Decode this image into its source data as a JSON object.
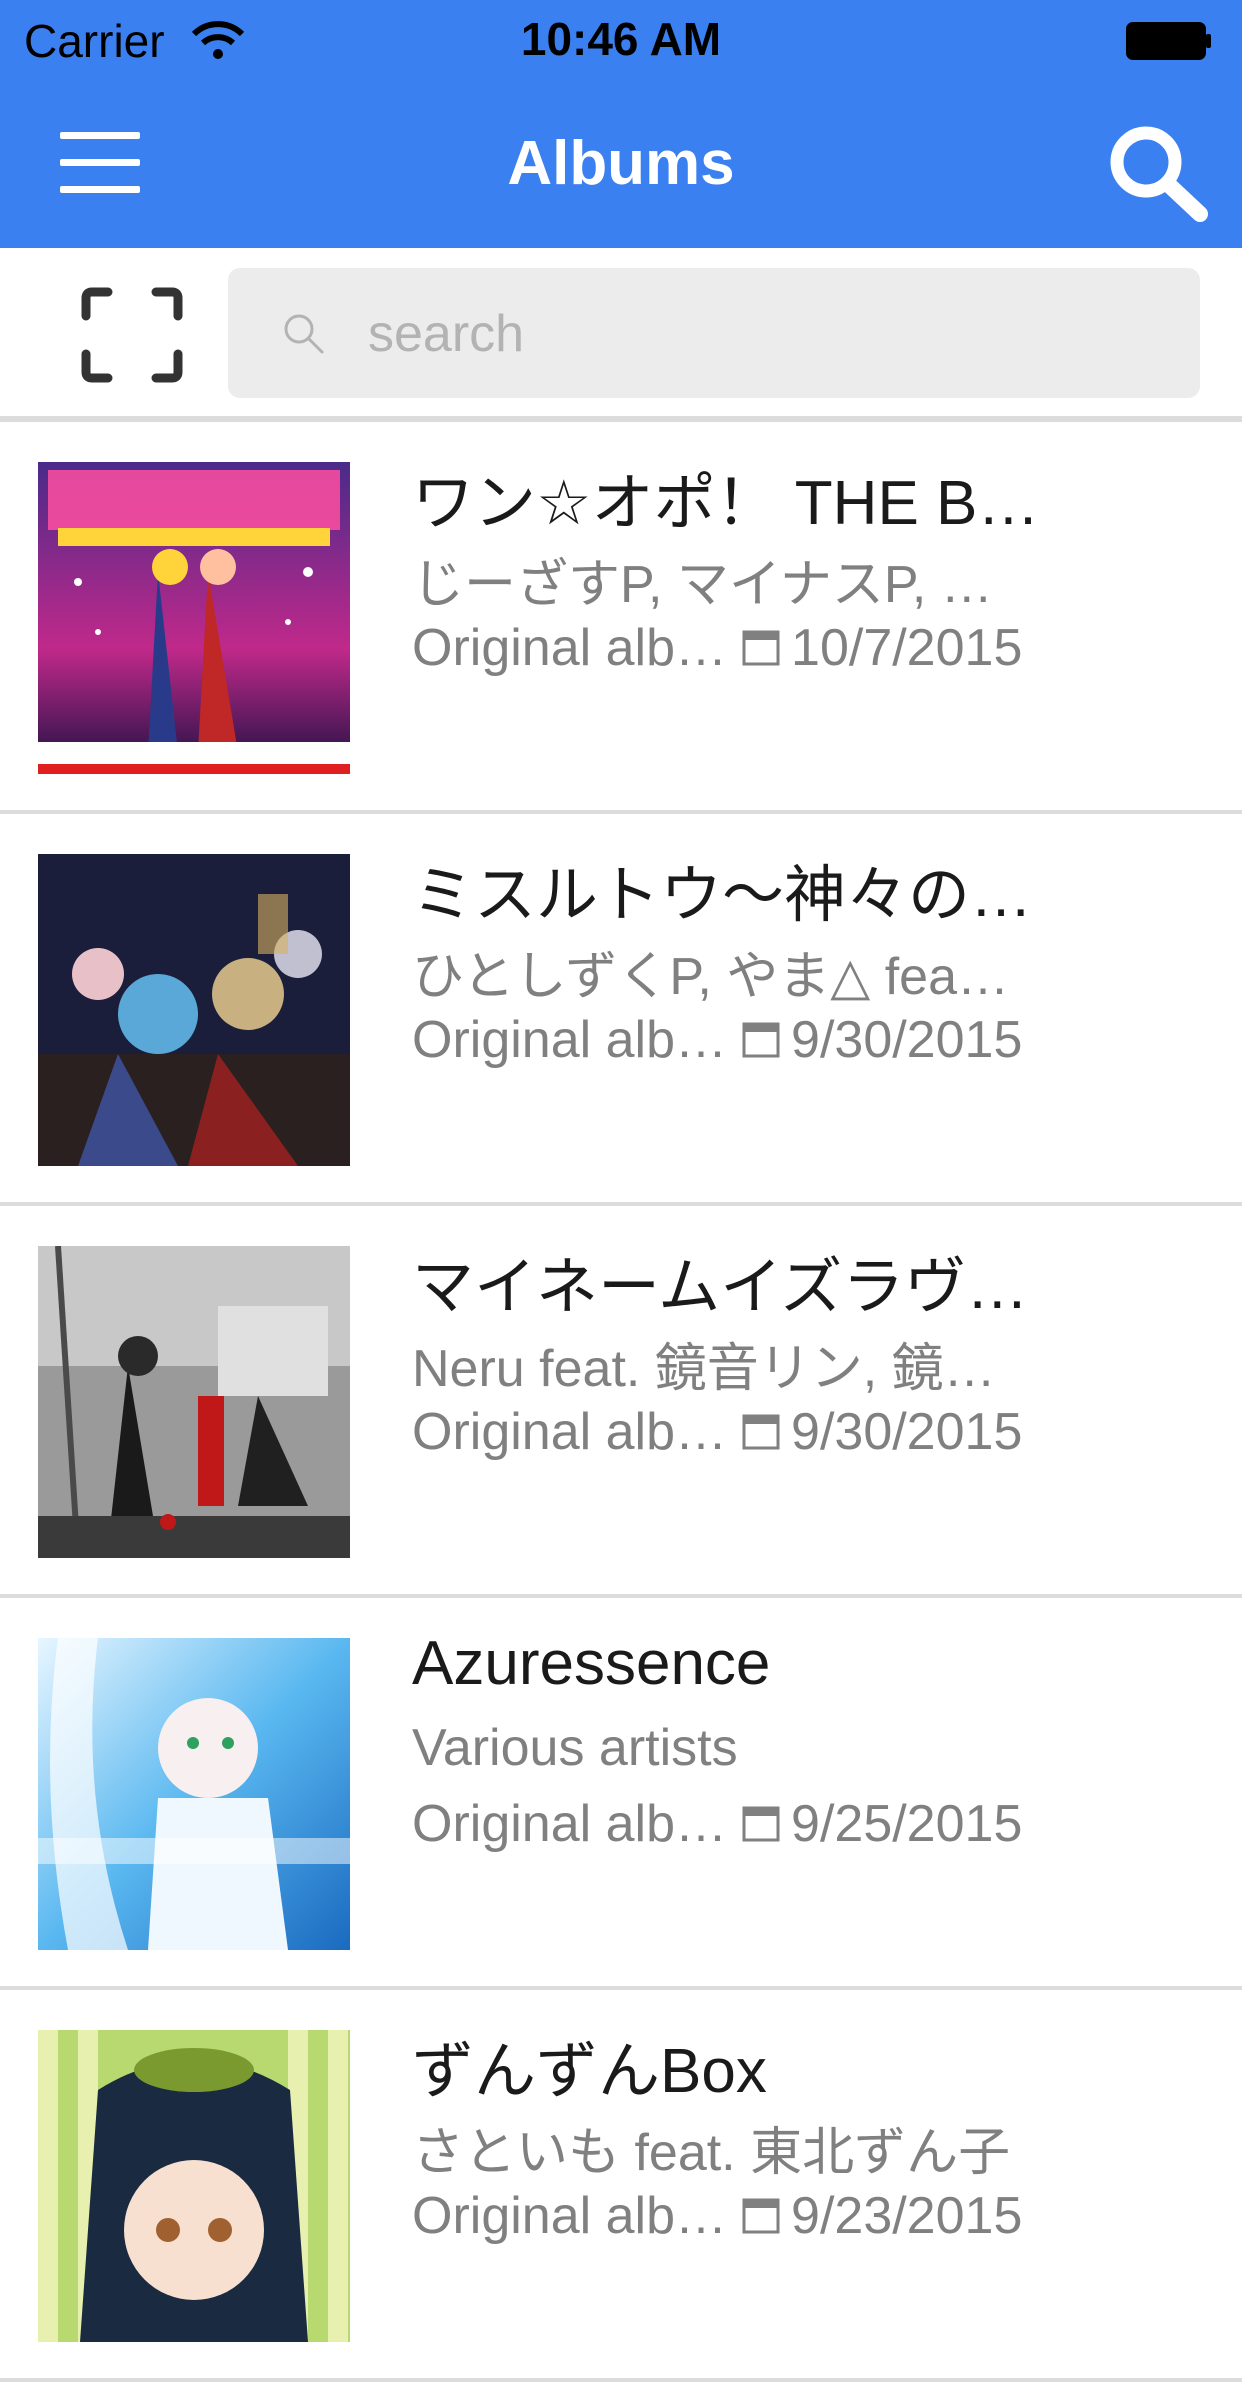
{
  "status_bar": {
    "carrier": "Carrier",
    "time": "10:46 AM"
  },
  "nav": {
    "title": "Albums",
    "menu_icon": "hamburger-icon",
    "search_icon": "search-icon"
  },
  "search": {
    "placeholder": "search",
    "value": "",
    "scan_icon": "scan-frame-icon"
  },
  "colors": {
    "accent": "#3b80f0",
    "secondary_text": "#808080",
    "primary_text": "#1a1a1a"
  },
  "albums": [
    {
      "title": "ワン☆オポ！ THE B…",
      "artists": "じーざすP, マイナスP, …",
      "type": "Original alb…",
      "date": "10/7/2015"
    },
    {
      "title": "ミスルトウ〜神々の…",
      "artists": "ひとしずくP, やま△ fea…",
      "type": "Original alb…",
      "date": "9/30/2015"
    },
    {
      "title": "マイネームイズラヴ…",
      "artists": "Neru feat. 鏡音リン, 鏡…",
      "type": "Original alb…",
      "date": "9/30/2015"
    },
    {
      "title": "Azuressence",
      "artists": "Various artists",
      "type": "Original alb…",
      "date": "9/25/2015"
    },
    {
      "title": "ずんずんBox",
      "artists": "さといも feat. 東北ずん子",
      "type": "Original alb…",
      "date": "9/23/2015"
    }
  ]
}
